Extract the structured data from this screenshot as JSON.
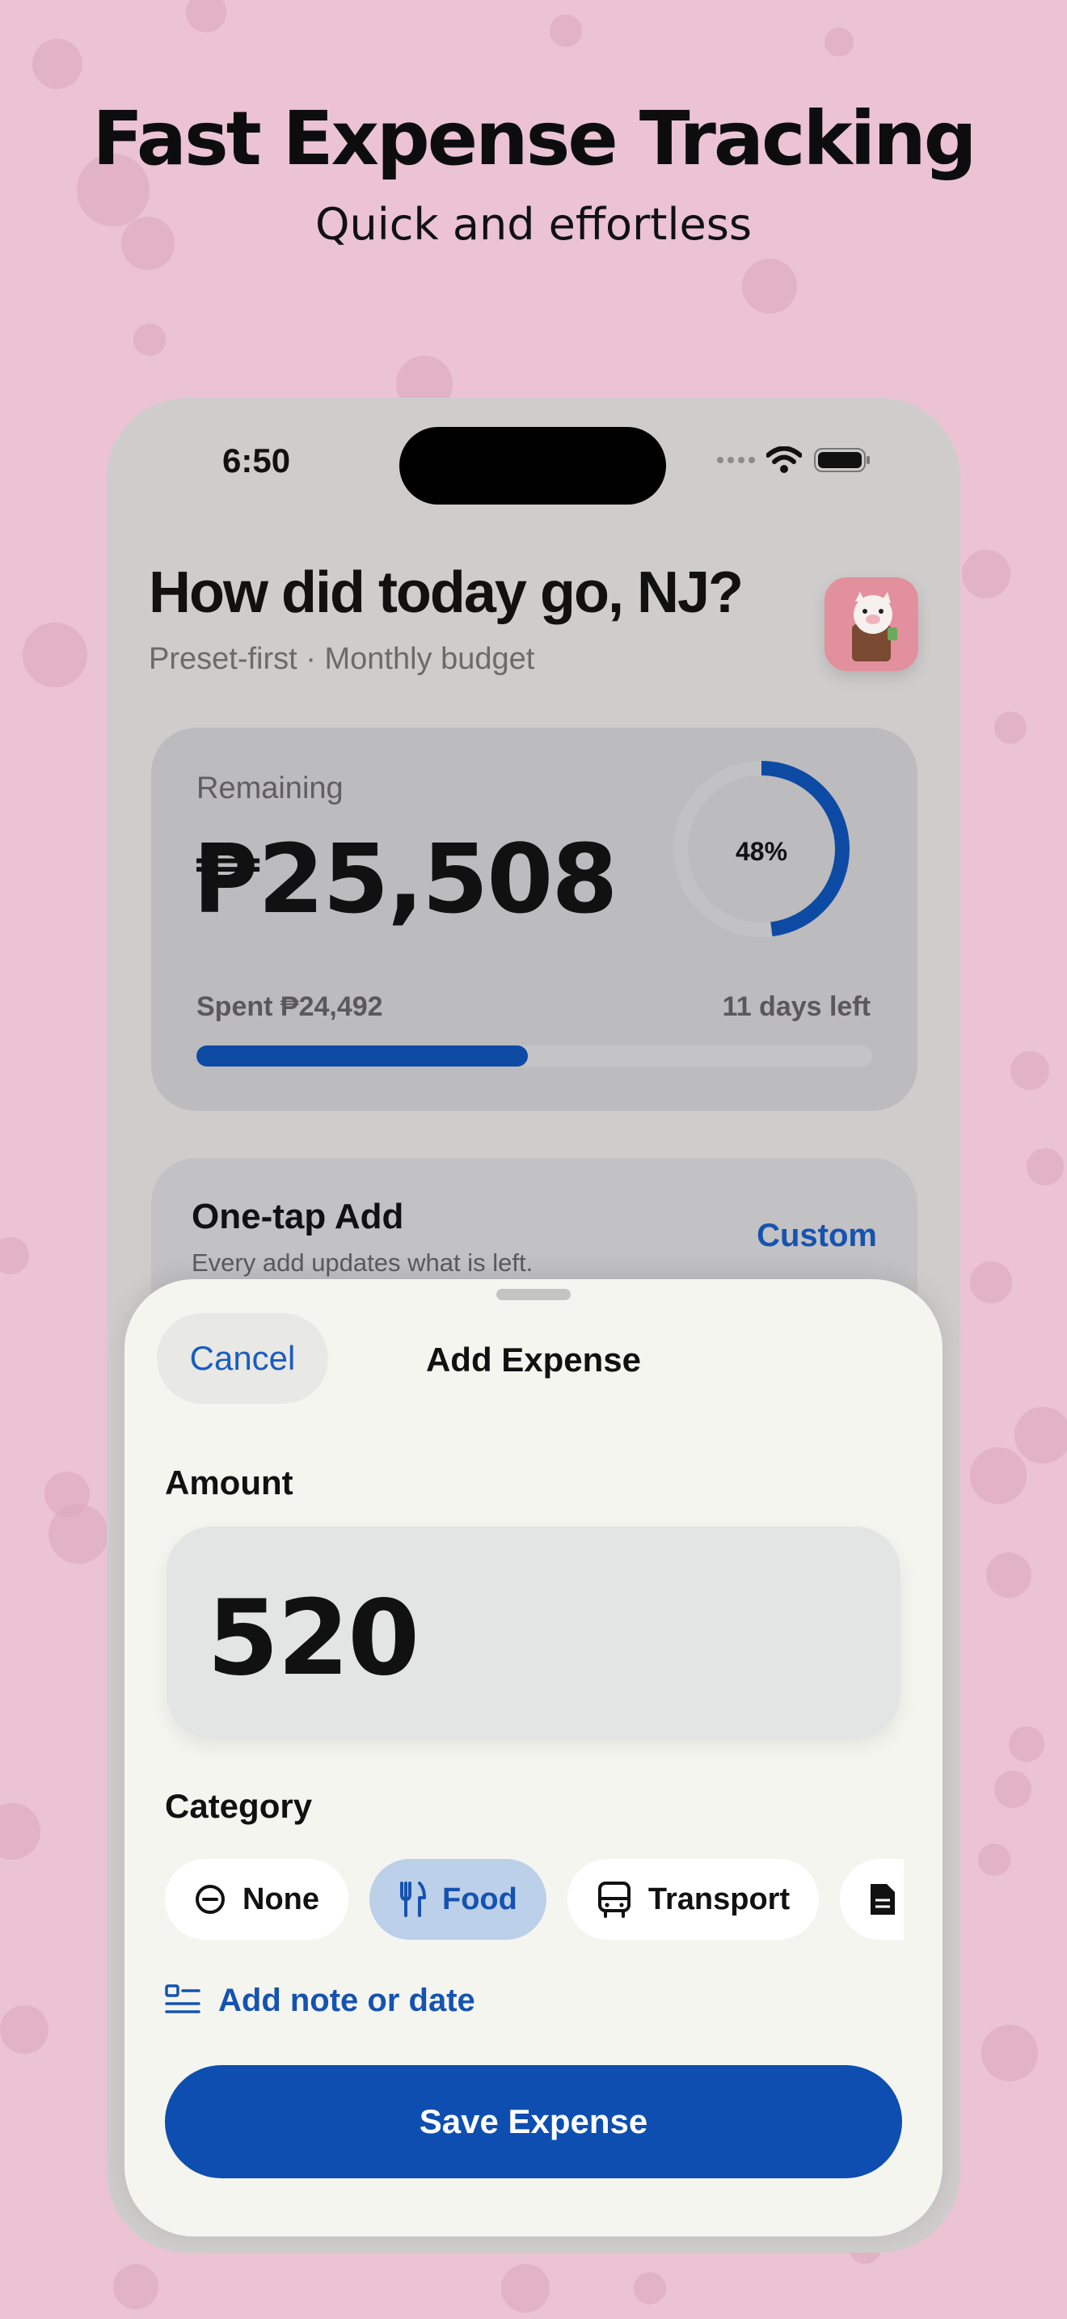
{
  "promo": {
    "headline": "Fast Expense Tracking",
    "subheadline": "Quick and effortless"
  },
  "status_bar": {
    "time": "6:50"
  },
  "home": {
    "greeting": "How did today go, NJ?",
    "subtitle": "Preset-first · Monthly budget",
    "budget": {
      "remaining_label": "Remaining",
      "remaining_value": "₱25,508",
      "ring_percent_label": "48%",
      "ring_fraction": 0.48,
      "spent_text": "Spent ₱24,492",
      "days_left_text": "11 days left",
      "progress_fraction": 0.49
    },
    "one_tap": {
      "title": "One-tap Add",
      "subtitle": "Every add updates what is left.",
      "custom_label": "Custom"
    }
  },
  "sheet": {
    "cancel_label": "Cancel",
    "title": "Add Expense",
    "amount_label": "Amount",
    "amount_value": "520",
    "category_label": "Category",
    "categories": [
      {
        "label": "None",
        "icon": "minus-circle-icon",
        "selected": false
      },
      {
        "label": "Food",
        "icon": "fork-knife-icon",
        "selected": true
      },
      {
        "label": "Transport",
        "icon": "bus-icon",
        "selected": false
      },
      {
        "label": "",
        "icon": "document-icon",
        "selected": false
      }
    ],
    "note_label": "Add note or date",
    "save_label": "Save Expense"
  },
  "colors": {
    "background": "#ebc3d3",
    "accent": "#0d4eb0",
    "selected_chip": "#bcd0ea"
  }
}
